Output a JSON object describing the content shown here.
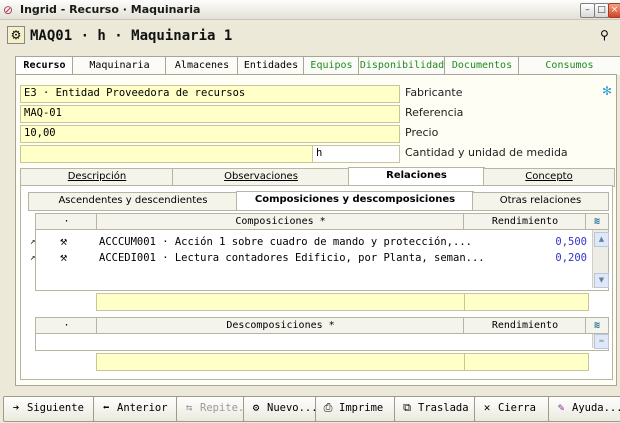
{
  "window": {
    "title": "Ingrid - Recurso · Maquinaria"
  },
  "header": {
    "title": "MAQ01 · h · Maquinaria 1"
  },
  "tabs": [
    "Recurso",
    "Maquinaria",
    "Almacenes",
    "Entidades",
    "Equipos",
    "Disponibilidad",
    "Documentos",
    "Consumos"
  ],
  "form": {
    "entity_value": "E3 · Entidad Proveedora de recursos",
    "entity_label": "Fabricante",
    "reference_value": "MAQ-01",
    "reference_label": "Referencia",
    "price_value": "10,00",
    "price_label": "Precio",
    "unit_value": "h",
    "unit_label": "Cantidad y unidad de medida"
  },
  "subtabs": [
    "Descripción",
    "Observaciones",
    "Relaciones",
    "Concepto"
  ],
  "subsubtabs": [
    "Ascendentes y descendientes",
    "Composiciones y descomposiciones",
    "Otras relaciones"
  ],
  "compositions": {
    "col_dot": "·",
    "header": "Composiciones *",
    "rend_header": "Rendimiento",
    "rows": [
      {
        "text": "ACCCUM001 · Acción 1 sobre cuadro de mando y protección,...",
        "value": "0,500"
      },
      {
        "text": "ACCEDI001 · Lectura contadores Edificio, por Planta, seman...",
        "value": "0,200"
      }
    ]
  },
  "decompositions": {
    "col_dot": "·",
    "header": "Descomposiciones *",
    "rend_header": "Rendimiento"
  },
  "toolbar": {
    "next": "Siguiente",
    "prev": "Anterior",
    "repeat": "Repite...",
    "new": "Nuevo...",
    "print": "Imprime",
    "move": "Traslada",
    "close": "Cierra",
    "help": "Ayuda..."
  }
}
